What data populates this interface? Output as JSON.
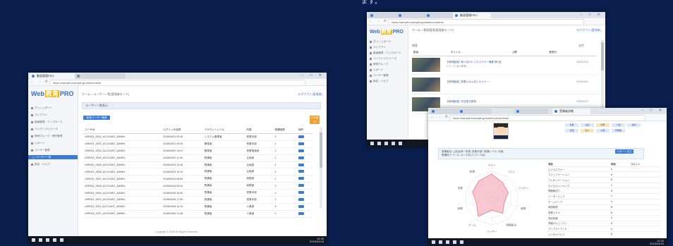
{
  "caption": "ます。",
  "left_window": {
    "title": "動画管理PRO",
    "url": "https://sample.example.jp/admin/users",
    "window_controls": "– □ ✕",
    "logo": {
      "a": "Web",
      "b": "教育",
      "c": "PRO"
    },
    "sidebar": [
      {
        "label": "ダッシュボード"
      },
      {
        "label": "ライブラリ"
      },
      {
        "label": "動画管理・アップロード"
      },
      {
        "label": "コンテンツ/シリーズ"
      },
      {
        "label": "研修グループ・教材管理"
      },
      {
        "label": "レポート"
      },
      {
        "label": "ユーザー管理"
      },
      {
        "label": "ユーザー一覧",
        "active": true
      },
      {
        "label": "設定・ヘルプ"
      }
    ],
    "breadcrumb": "ホーム > ユーザー一覧(管理者モード)",
    "user_link": "ログアウト(管理者)",
    "section_title": "ユーザー一覧表示",
    "add_button": "新規ユーザー登録",
    "csv_button": "CSV出力",
    "columns": [
      "ユーザID",
      "ログインID名称",
      "アカウントレベル",
      "所属",
      "受講回数",
      "操作"
    ],
    "rows": [
      {
        "id": "USR001_0001_ACCOUNT_ADMIN",
        "login": "2018/04/01 09:15",
        "level": "システム管理者",
        "dept": "営業本部",
        "count": "3"
      },
      {
        "id": "USR001_0002_ACCOUNT_ADMIN",
        "login": "2018/04/01 09:20",
        "level": "管理者",
        "dept": "営業本部",
        "count": "1"
      },
      {
        "id": "USR001_0003_ACCOUNT_ADMIN",
        "login": "2018/04/02 10:01",
        "level": "管理者",
        "dept": "営業推進部",
        "count": "2"
      },
      {
        "id": "USR001_0004_ACCOUNT_ADMIN",
        "login": "2018/04/02 11:30",
        "level": "受講者",
        "dept": "企画部",
        "count": "1"
      },
      {
        "id": "USR001_0005_ACCOUNT_ADMIN",
        "login": "2018/04/03 13:45",
        "level": "受講者",
        "dept": "企画部",
        "count": "4"
      },
      {
        "id": "USR001_0006_ACCOUNT_ADMIN",
        "login": "2018/04/03 14:12",
        "level": "受講者",
        "dept": "企画部",
        "count": "2"
      },
      {
        "id": "USR001_0007_ACCOUNT_ADMIN",
        "login": "2018/04/04 08:55",
        "level": "受講者",
        "dept": "総務部",
        "count": "1"
      },
      {
        "id": "USR001_0008_ACCOUNT_ADMIN",
        "login": "2018/04/04 09:40",
        "level": "受講者",
        "dept": "総務部",
        "count": "3"
      },
      {
        "id": "USR001_0009_ACCOUNT_ADMIN",
        "login": "2018/04/05 16:20",
        "level": "受講者",
        "dept": "営業本部",
        "count": "2"
      },
      {
        "id": "USR001_0010_ACCOUNT_ADMIN",
        "login": "2018/04/05 17:05",
        "level": "受講者",
        "dept": "営業本部",
        "count": "1"
      },
      {
        "id": "USR001_0011_ACCOUNT_ADMIN",
        "login": "2018/04/06 10:10",
        "level": "受講者",
        "dept": "人事部",
        "count": "5"
      },
      {
        "id": "USR001_0012_ACCOUNT_ADMIN",
        "login": "2018/04/06 11:48",
        "level": "受講者",
        "dept": "人事部",
        "count": "2"
      }
    ],
    "footer": "Copyright © 2018 All Rights Reserved.",
    "clock": {
      "time": "14:35",
      "date": "2018/04/18"
    }
  },
  "top_right_window": {
    "title": "動画管理PRO",
    "url": "https://sample.example.jp/admin/contents",
    "breadcrumb": "ホーム > 動画管理(管理者モード)",
    "search_label": "検索",
    "filter_label": "全件",
    "columns": [
      "動画",
      "タイトル",
      "公開",
      "登録日"
    ],
    "videos": [
      {
        "title": "【研修動画】新人向けビジネスマナー講座 第1回",
        "sub": "シリーズ: 新人研修",
        "date": "2018/03/12"
      },
      {
        "title": "【研修動画】営業スキル向上セミナー",
        "sub": "",
        "date": "2018/03/20"
      },
      {
        "title": "【研修動画】安全衛生教育",
        "sub": "",
        "date": "2018/04/02"
      }
    ],
    "sidebar": [
      "ダッシュボード",
      "ライブラリ",
      "動画管理・アップロード",
      "コンテンツ/シリーズ",
      "研修グループ",
      "レポート",
      "ユーザー管理",
      "設定・ヘルプ"
    ]
  },
  "bottom_right_window": {
    "title": "受講者詳細",
    "url": "https://sample.example.jp/admin/users/detail",
    "info_line1": "受講者名: 山田太郎 / 所属: 営業本部 / 受講レベル: 中級",
    "info_line2": "受講完了コース: 12 / 平均スコア: 78点",
    "info_button": "レポート出力",
    "tags": [
      "営業",
      "企画",
      "総務",
      "人事",
      "技術",
      "管理",
      "新人",
      "中堅",
      "管理職"
    ],
    "skills_header": [
      "項目",
      "評価",
      "コメント"
    ],
    "skills": [
      {
        "name": "ビジネスマナー",
        "grade": "A"
      },
      {
        "name": "コミュニケーション",
        "grade": "B"
      },
      {
        "name": "プレゼンテーション",
        "grade": "B"
      },
      {
        "name": "ロジカルシンキング",
        "grade": "C"
      },
      {
        "name": "問題解決力",
        "grade": "B"
      },
      {
        "name": "リーダーシップ",
        "grade": "C"
      },
      {
        "name": "チームワーク",
        "grade": "A"
      },
      {
        "name": "時間管理",
        "grade": "B"
      },
      {
        "name": "営業スキル",
        "grade": "B"
      },
      {
        "name": "商品知識",
        "grade": "A"
      },
      {
        "name": "情報セキュリティ",
        "grade": "B"
      },
      {
        "name": "コンプライアンス",
        "grade": "A"
      },
      {
        "name": "メンタルヘルス",
        "grade": "B"
      },
      {
        "name": "OAスキル",
        "grade": "B"
      },
      {
        "name": "英語",
        "grade": "C"
      },
      {
        "name": "マネジメント",
        "grade": "C"
      }
    ],
    "radar": {
      "labels": [
        "マナー",
        "コミュ",
        "プレゼン",
        "論理",
        "問題解決",
        "リーダー",
        "チーム",
        "時間",
        "営業",
        "知識"
      ],
      "values": [
        0.9,
        0.7,
        0.65,
        0.5,
        0.7,
        0.45,
        0.85,
        0.6,
        0.75,
        0.8
      ]
    }
  }
}
